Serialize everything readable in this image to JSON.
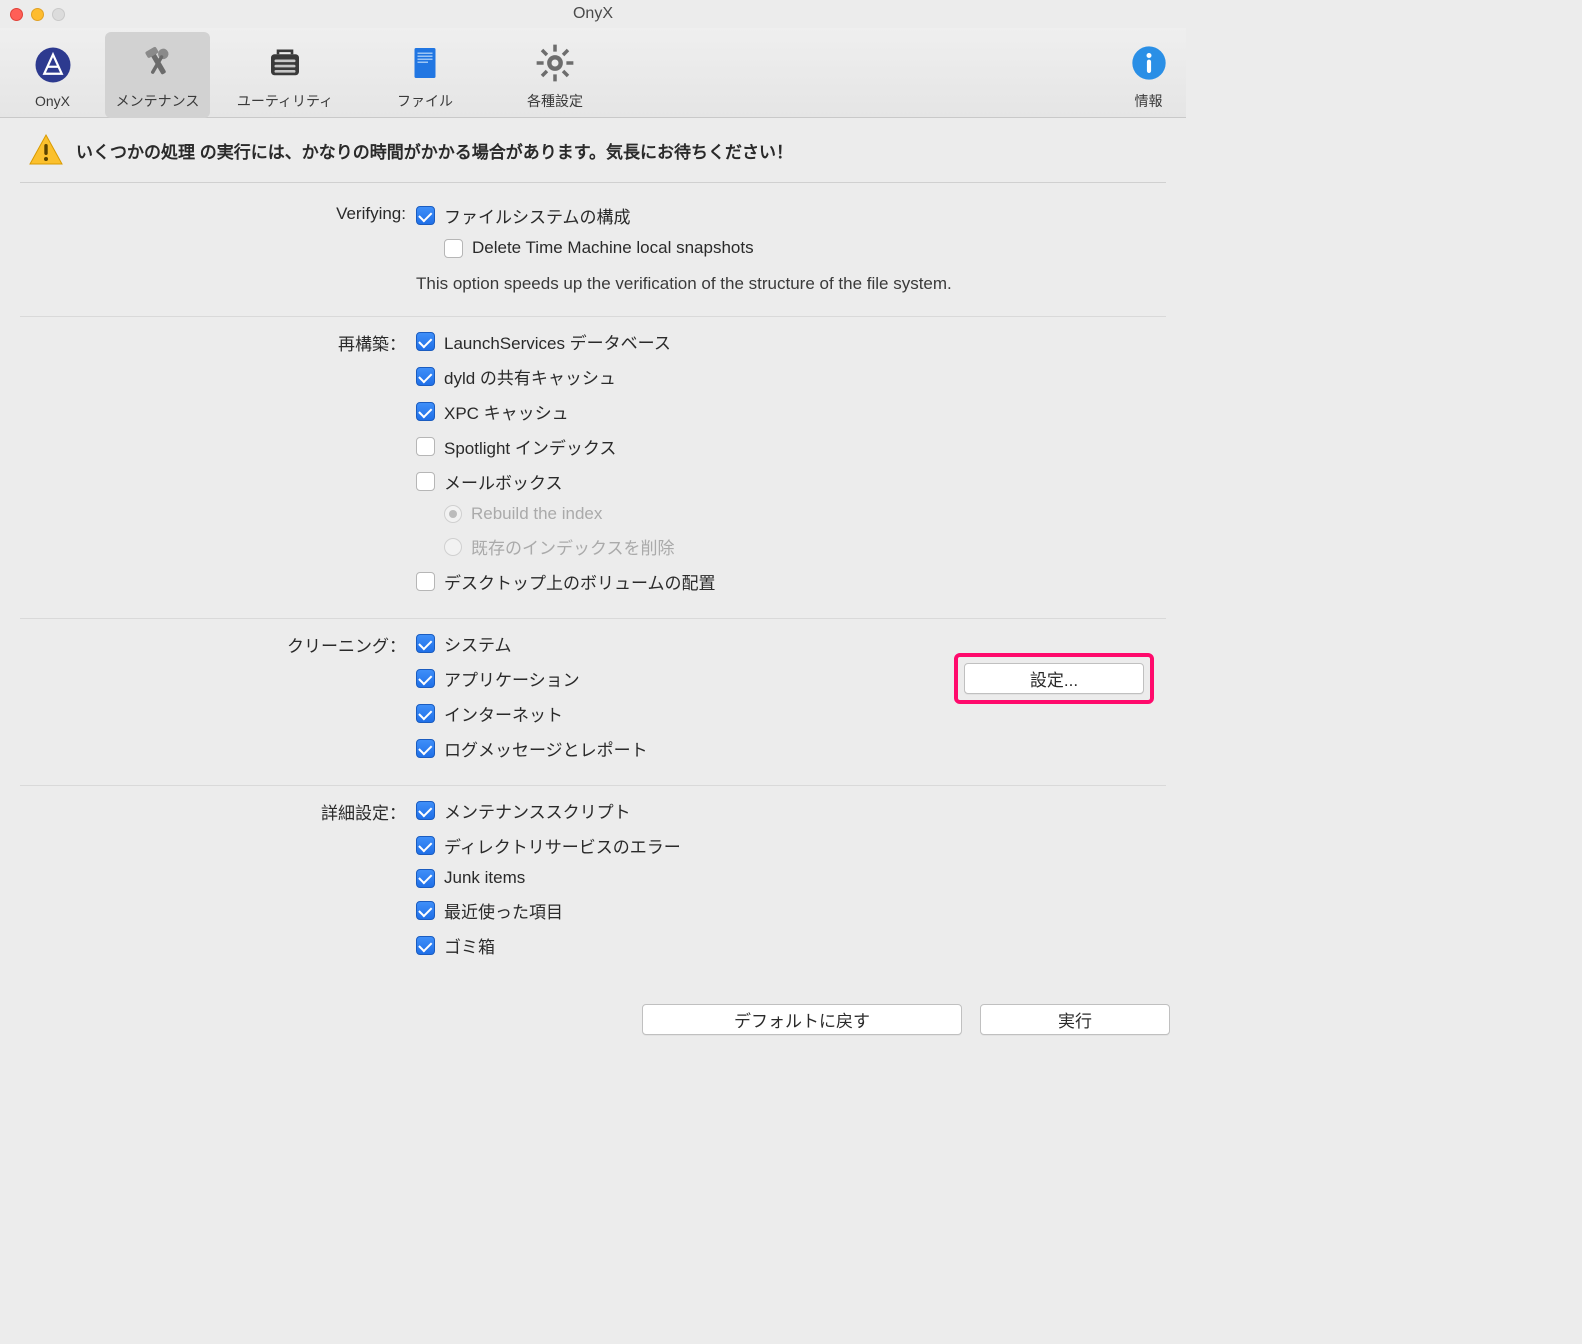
{
  "window": {
    "title": "OnyX"
  },
  "toolbar": {
    "items": [
      {
        "id": "onyx",
        "label": "OnyX"
      },
      {
        "id": "maintenance",
        "label": "メンテナンス"
      },
      {
        "id": "utilities",
        "label": "ユーティリティ"
      },
      {
        "id": "files",
        "label": "ファイル"
      },
      {
        "id": "settings",
        "label": "各種設定"
      }
    ],
    "info_label": "情報"
  },
  "warning": {
    "text": "いくつかの処理 の実行には、かなりの時間がかかる場合があります。気長にお待ちください！"
  },
  "sections": {
    "verifying": {
      "label": "Verifying:",
      "opt_filesystem": "ファイルシステムの構成",
      "opt_delete_tm": "Delete Time Machine local snapshots",
      "note": "This option speeds up the verification of the structure of the file system."
    },
    "rebuild": {
      "label": "再構築：",
      "opt_launchservices": "LaunchServices データベース",
      "opt_dyld": "dyld の共有キャッシュ",
      "opt_xpc": "XPC キャッシュ",
      "opt_spotlight": "Spotlight インデックス",
      "opt_mailboxes": "メールボックス",
      "radio_rebuild_index": "Rebuild the index",
      "radio_delete_index": "既存のインデックスを削除",
      "opt_desktop_volumes": "デスクトップ上のボリュームの配置"
    },
    "cleaning": {
      "label": "クリーニング：",
      "opt_system": "システム",
      "opt_applications": "アプリケーション",
      "opt_internet": "インターネット",
      "opt_logs": "ログメッセージとレポート",
      "settings_button": "設定..."
    },
    "advanced": {
      "label": "詳細設定：",
      "opt_maintenance_scripts": "メンテナンススクリプト",
      "opt_directory_services": "ディレクトリサービスのエラー",
      "opt_junk": "Junk items",
      "opt_recent": "最近使った項目",
      "opt_trash": "ゴミ箱"
    }
  },
  "buttons": {
    "defaults": "デフォルトに戻す",
    "run": "実行"
  }
}
